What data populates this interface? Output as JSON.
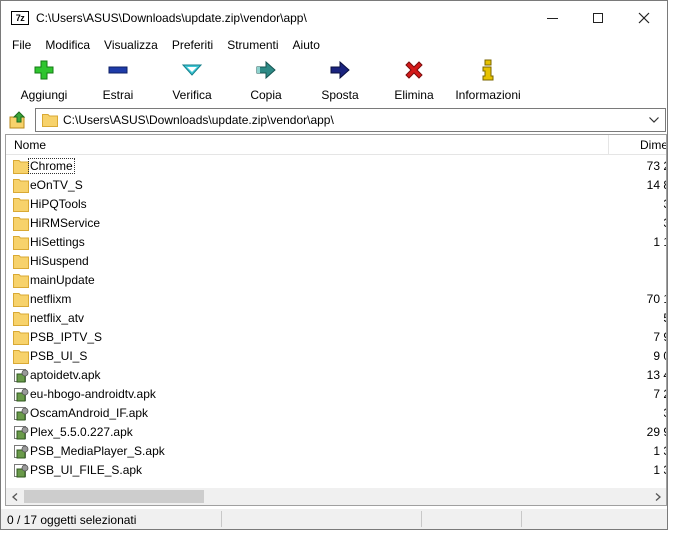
{
  "window": {
    "title": "C:\\Users\\ASUS\\Downloads\\update.zip\\vendor\\app\\",
    "app_icon": "7z"
  },
  "menu": [
    "File",
    "Modifica",
    "Visualizza",
    "Preferiti",
    "Strumenti",
    "Aiuto"
  ],
  "toolbar": [
    {
      "label": "Aggiungi",
      "icon": "plus-icon"
    },
    {
      "label": "Estrai",
      "icon": "minus-icon"
    },
    {
      "label": "Verifica",
      "icon": "check-icon"
    },
    {
      "label": "Copia",
      "icon": "copy-arrow-icon"
    },
    {
      "label": "Sposta",
      "icon": "move-arrow-icon"
    },
    {
      "label": "Elimina",
      "icon": "delete-x-icon"
    },
    {
      "label": "Informazioni",
      "icon": "info-icon"
    }
  ],
  "address": {
    "path": "C:\\Users\\ASUS\\Downloads\\update.zip\\vendor\\app\\"
  },
  "columns": {
    "name": "Nome",
    "size": "Dime"
  },
  "files": [
    {
      "name": "Chrome",
      "type": "folder",
      "size": "73 2"
    },
    {
      "name": "eOnTV_S",
      "type": "folder",
      "size": "14 8"
    },
    {
      "name": "HiPQTools",
      "type": "folder",
      "size": "3"
    },
    {
      "name": "HiRMService",
      "type": "folder",
      "size": "3"
    },
    {
      "name": "HiSettings",
      "type": "folder",
      "size": "1 1"
    },
    {
      "name": "HiSuspend",
      "type": "folder",
      "size": ""
    },
    {
      "name": "mainUpdate",
      "type": "folder",
      "size": ""
    },
    {
      "name": "netflixm",
      "type": "folder",
      "size": "70 1"
    },
    {
      "name": "netflix_atv",
      "type": "folder",
      "size": "5"
    },
    {
      "name": "PSB_IPTV_S",
      "type": "folder",
      "size": "7 9"
    },
    {
      "name": "PSB_UI_S",
      "type": "folder",
      "size": "9 0"
    },
    {
      "name": "aptoidetv.apk",
      "type": "file",
      "size": "13 4"
    },
    {
      "name": "eu-hbogo-androidtv.apk",
      "type": "file",
      "size": "7 2"
    },
    {
      "name": "OscamAndroid_IF.apk",
      "type": "file",
      "size": "3"
    },
    {
      "name": "Plex_5.5.0.227.apk",
      "type": "file",
      "size": "29 9"
    },
    {
      "name": "PSB_MediaPlayer_S.apk",
      "type": "file",
      "size": "1 3"
    },
    {
      "name": "PSB_UI_FILE_S.apk",
      "type": "file",
      "size": "1 3"
    }
  ],
  "status": {
    "selection": "0 / 17 oggetti selezionati"
  },
  "colors": {
    "folder": "#f7d26b",
    "folder_edge": "#d9a934",
    "add_green": "#2fc52f",
    "extract_blue": "#1e3ba8",
    "verify_cyan": "#3fc7d6",
    "copy_teal": "#2d8a86",
    "move_navy": "#1a237e",
    "delete_red": "#d41a1a",
    "info_yellow": "#e6c200"
  }
}
